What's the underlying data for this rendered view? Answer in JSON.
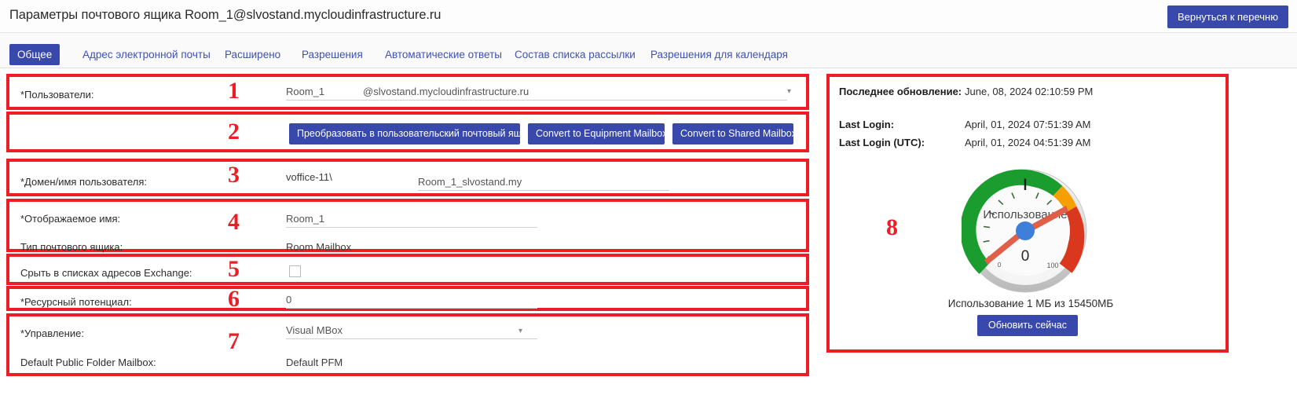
{
  "header": {
    "title": "Параметры почтового ящика Room_1@slvostand.mycloudinfrastructure.ru",
    "back_button": "Вернуться к перечню",
    "accent_color": "#3949ab"
  },
  "tabs": [
    {
      "label": "Общее",
      "active": true
    },
    {
      "label": "Адрес электронной почты",
      "active": false
    },
    {
      "label": "Расширено",
      "active": false
    },
    {
      "label": "Разрешения",
      "active": false
    },
    {
      "label": "Автоматические ответы",
      "active": false
    },
    {
      "label": "Состав списка рассылки",
      "active": false
    },
    {
      "label": "Разрешения для календаря",
      "active": false
    }
  ],
  "markers": {
    "one": "1",
    "two": "2",
    "three": "3",
    "four": "4",
    "five": "5",
    "six": "6",
    "seven": "7",
    "eight": "8",
    "color": "#ee1c25"
  },
  "section1": {
    "label": "*Пользователи:",
    "username_value": "Room_1",
    "domain_value": "@slvostand.mycloudinfrastructure.ru"
  },
  "section2": {
    "convert_user": "Преобразовать в пользовательский почтовый ящик",
    "convert_equipment": "Convert to Equipment Mailbox",
    "convert_shared": "Convert to Shared Mailbox"
  },
  "section3": {
    "label": "*Домен/имя пользователя:",
    "domain_value": "voffice-11\\",
    "user_value": "Room_1_slvostand.my"
  },
  "section4": {
    "display_name_label": "*Отображаемое имя:",
    "display_name_value": "Room_1",
    "mailbox_type_label": "Тип почтового ящика:",
    "mailbox_type_value": "Room Mailbox"
  },
  "section5": {
    "label": "Срыть в списках адресов Exchange:",
    "checked": false
  },
  "section6": {
    "label": "*Ресурсный потенциал:",
    "value": "0"
  },
  "section7": {
    "management_label": "*Управление:",
    "management_value": "Visual MBox",
    "pfm_label": "Default Public Folder Mailbox:",
    "pfm_value": "Default PFM"
  },
  "section8": {
    "last_update_label": "Последнее обновление:",
    "last_update_value": "June, 08, 2024 02:10:59 PM",
    "last_login_label": "Last Login:",
    "last_login_value": "April, 01, 2024 07:51:39 AM",
    "last_login_utc_label": "Last Login (UTC):",
    "last_login_utc_value": "April, 01, 2024 04:51:39 AM",
    "usage_text": "Использование 1 МБ из 15450МБ",
    "refresh_button": "Обновить сейчас"
  },
  "chart_data": {
    "type": "gauge",
    "title": "Использование",
    "value": 0,
    "reading_label": "0",
    "min": 0,
    "max": 15450,
    "tick_labels": [
      "0",
      "100"
    ],
    "units": "МБ",
    "bands": [
      {
        "from": 0,
        "to": 70,
        "color": "#1a9c2e"
      },
      {
        "from": 70,
        "to": 88,
        "color": "#f5a000"
      },
      {
        "from": 88,
        "to": 100,
        "color": "#d9381e"
      }
    ],
    "needle_color": "#e05f49",
    "hub_color": "#3d7fd9",
    "caption": "Использование 1 МБ из 15450МБ"
  }
}
